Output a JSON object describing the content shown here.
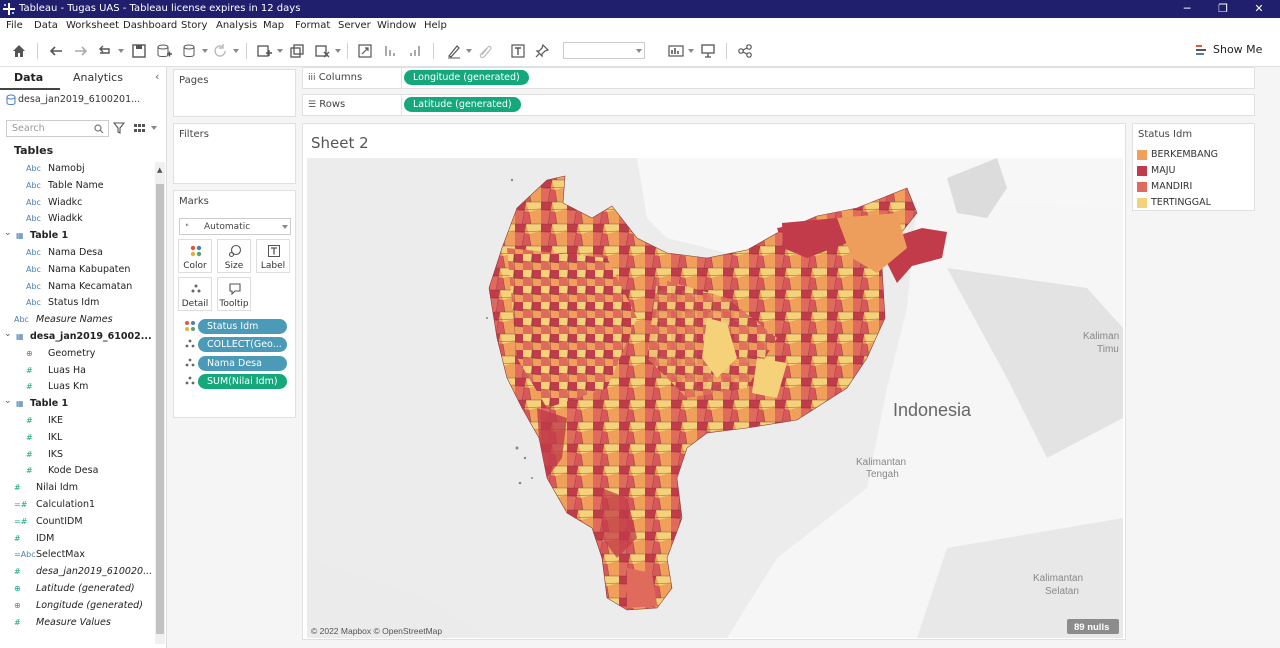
{
  "window": {
    "title": "Tableau - Tugas UAS - Tableau license expires in 12 days"
  },
  "menu": [
    "File",
    "Data",
    "Worksheet",
    "Dashboard",
    "Story",
    "Analysis",
    "Map",
    "Format",
    "Server",
    "Window",
    "Help"
  ],
  "toolbar": {
    "show_me": "Show Me"
  },
  "left_pane": {
    "tabs": [
      "Data",
      "Analytics"
    ],
    "datasource": "desa_jan2019_6100201...",
    "search_placeholder": "Search",
    "tables_heading": "Tables",
    "fields": [
      {
        "icon": "Abc",
        "label": "Namobj",
        "kind": "dim"
      },
      {
        "icon": "Abc",
        "label": "Table Name",
        "kind": "dim"
      },
      {
        "icon": "Abc",
        "label": "Wiadkc",
        "kind": "dim"
      },
      {
        "icon": "Abc",
        "label": "Wiadkk",
        "kind": "dim"
      },
      {
        "icon": "▦",
        "label": "Table 1",
        "kind": "group"
      },
      {
        "icon": "Abc",
        "label": "Nama Desa",
        "kind": "dim"
      },
      {
        "icon": "Abc",
        "label": "Nama Kabupaten",
        "kind": "dim"
      },
      {
        "icon": "Abc",
        "label": "Nama Kecamatan",
        "kind": "dim"
      },
      {
        "icon": "Abc",
        "label": "Status Idm",
        "kind": "dim"
      },
      {
        "icon": "Abc",
        "label": "Measure Names",
        "kind": "italic"
      },
      {
        "icon": "▦",
        "label": "desa_jan2019_61002...",
        "kind": "group"
      },
      {
        "icon": "⊕",
        "label": "Geometry",
        "kind": "dim"
      },
      {
        "icon": "#",
        "label": "Luas Ha",
        "kind": "meas"
      },
      {
        "icon": "#",
        "label": "Luas Km",
        "kind": "meas"
      },
      {
        "icon": "▦",
        "label": "Table 1",
        "kind": "group"
      },
      {
        "icon": "#",
        "label": "IKE",
        "kind": "meas"
      },
      {
        "icon": "#",
        "label": "IKL",
        "kind": "meas"
      },
      {
        "icon": "#",
        "label": "IKS",
        "kind": "meas"
      },
      {
        "icon": "#",
        "label": "Kode Desa",
        "kind": "meas"
      },
      {
        "icon": "#",
        "label": "Nilai Idm",
        "kind": "meas"
      },
      {
        "icon": "=#",
        "label": "Calculation1",
        "kind": "meas"
      },
      {
        "icon": "=#",
        "label": "CountIDM",
        "kind": "meas"
      },
      {
        "icon": "#",
        "label": "IDM",
        "kind": "meas"
      },
      {
        "icon": "=Abc",
        "label": "SelectMax",
        "kind": "dim"
      },
      {
        "icon": "#",
        "label": "desa_jan2019_610020...",
        "kind": "italic"
      },
      {
        "icon": "⊕",
        "label": "Latitude (generated)",
        "kind": "italic"
      },
      {
        "icon": "⊕",
        "label": "Longitude (generated)",
        "kind": "italic"
      },
      {
        "icon": "#",
        "label": "Measure Values",
        "kind": "italic"
      }
    ]
  },
  "cards": {
    "pages": "Pages",
    "filters": "Filters",
    "marks": "Marks",
    "mark_type": "Automatic",
    "mark_buttons": [
      "Color",
      "Size",
      "Label",
      "Detail",
      "Tooltip"
    ],
    "mark_pills": [
      "Status Idm",
      "COLLECT(Geo...",
      "Nama Desa",
      "SUM(Nilai Idm)"
    ]
  },
  "shelves": {
    "columns_label": "Columns",
    "columns_pill": "Longitude (generated)",
    "rows_label": "Rows",
    "rows_pill": "Latitude (generated)"
  },
  "sheet": {
    "title": "Sheet 2",
    "map_labels": {
      "country": "Indonesia",
      "kaltim_1": "Kaliman",
      "kaltim_2": "Timu",
      "kalteng_1": "Kalimantan",
      "kalteng_2": "Tengah",
      "kalsel_1": "Kalimantan",
      "kalsel_2": "Selatan"
    },
    "attribution": "© 2022 Mapbox © OpenStreetMap",
    "nulls": "89 nulls"
  },
  "legend": {
    "title": "Status Idm",
    "items": [
      {
        "label": "BERKEMBANG",
        "color": "#f0a05a"
      },
      {
        "label": "MAJU",
        "color": "#c23b4a"
      },
      {
        "label": "MANDIRI",
        "color": "#e06a5c"
      },
      {
        "label": "TERTINGGAL",
        "color": "#f5d27a"
      }
    ]
  }
}
